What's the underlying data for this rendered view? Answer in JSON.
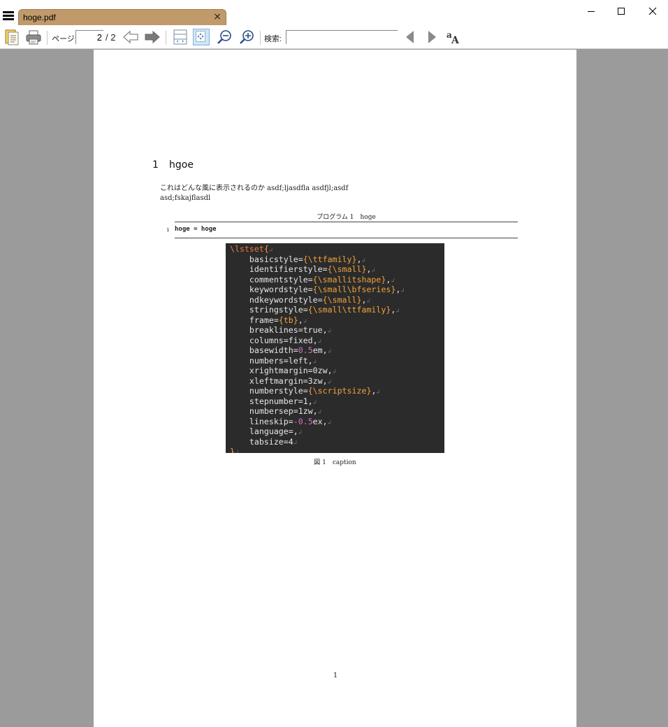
{
  "window": {
    "tab_title": "hoge.pdf",
    "tab_close": "×"
  },
  "toolbar": {
    "page_label": "ページ:",
    "page_value": "2",
    "page_total": "/ 2",
    "search_label": "検索:",
    "search_value": "",
    "icons": [
      "bookmarks-icon",
      "print-icon",
      "prev-page-icon",
      "next-page-icon",
      "fit-width-icon",
      "fit-page-icon",
      "zoom-out-icon",
      "zoom-in-icon",
      "find-prev-icon",
      "find-next-icon",
      "match-case-icon"
    ]
  },
  "document": {
    "section_number": "1",
    "section_title": "hgoe",
    "paragraph_line1": "これはどんな風に表示されるのか asdf;ljasdfla asdfjl;asdf",
    "paragraph_line2": "asd;fskajflasdl",
    "listing_caption": "プログラム 1　hoge",
    "listing_line_number": "1",
    "listing_code": "hoge = hoge",
    "figure_caption": "図 1　caption",
    "page_number": "1",
    "code_image_lines": [
      "\\lstset{",
      "    basicstyle={\\ttfamily},",
      "    identifierstyle={\\small},",
      "    commentstyle={\\smallitshape},",
      "    keywordstyle={\\small\\bfseries},",
      "    ndkeywordstyle={\\small},",
      "    stringstyle={\\small\\ttfamily},",
      "    frame={tb},",
      "    breaklines=true,",
      "    columns=fixed,",
      "    basewidth=0.5em,",
      "    numbers=left,",
      "    xrightmargin=0zw,",
      "    xleftmargin=3zw,",
      "    numberstyle={\\scriptsize},",
      "    stepnumber=1,",
      "    numbersep=1zw,",
      "    lineskip=-0.5ex,",
      "    language=,",
      "    tabsize=4",
      "}"
    ]
  },
  "colors": {
    "tab": "#c19a6b",
    "viewer_bg": "#9b9b9b",
    "code_bg": "#2b2b2b",
    "code_keyword": "#f07a3c",
    "code_arg": "#f0a23c",
    "code_number": "#d86fc6"
  }
}
